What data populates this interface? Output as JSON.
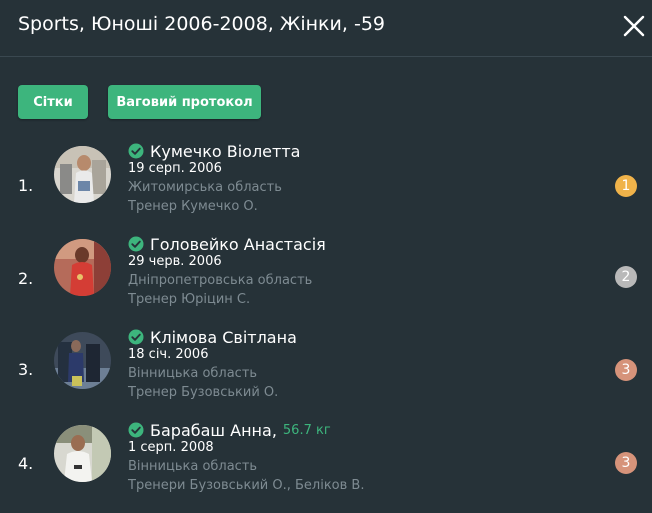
{
  "header": {
    "title": "Sports, Юноші 2006-2008, Жінки, -59"
  },
  "buttons": {
    "grids": "Сітки",
    "weigh_protocol": "Ваговий протокол"
  },
  "athletes": [
    {
      "rank": "1.",
      "name": "Кумечко Віолетта",
      "weight": "",
      "dob": "19 серп. 2006",
      "region": "Житомирська область",
      "coach": "Тренер Кумечко О.",
      "medal": "1",
      "medal_color": "#f0b34a"
    },
    {
      "rank": "2.",
      "name": "Головейко Анастасія",
      "weight": "",
      "dob": "29 черв. 2006",
      "region": "Дніпропетровська область",
      "coach": "Тренер Юріцин С.",
      "medal": "2",
      "medal_color": "#b9b9b9"
    },
    {
      "rank": "3.",
      "name": "Клімова Світлана",
      "weight": "",
      "dob": "18 січ. 2006",
      "region": "Вінницька область",
      "coach": "Тренер Бузовський О.",
      "medal": "3",
      "medal_color": "#d6937a"
    },
    {
      "rank": "4.",
      "name": "Барабаш Анна,",
      "weight": "56.7 кг",
      "dob": "1 серп. 2008",
      "region": "Вінницька область",
      "coach": "Тренери Бузовський О.,  Беліков В.",
      "medal": "3",
      "medal_color": "#d6937a"
    }
  ],
  "colors": {
    "background": "#263238",
    "accent": "#3db57d",
    "muted_text": "#7e8b92"
  },
  "icons": {
    "close": "close-icon",
    "verified": "check-circle-icon"
  }
}
